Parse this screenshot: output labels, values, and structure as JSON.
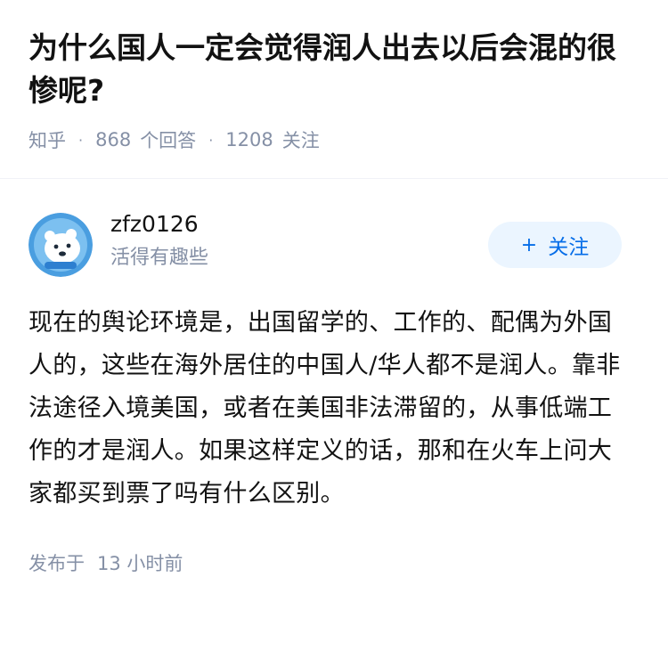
{
  "question": {
    "title": "为什么国人一定会觉得润人出去以后会混的很惨呢?",
    "source": "知乎",
    "answer_count": "868",
    "answer_label": "个回答",
    "follower_count": "1208",
    "follower_label": "关注"
  },
  "answer": {
    "author_name": "zfz0126",
    "author_bio": "活得有趣些",
    "follow_button": {
      "icon": "+",
      "label": "关注"
    },
    "content": "现在的舆论环境是，出国留学的、工作的、配偶为外国人的，这些在海外居住的中国人/华人都不是润人。靠非法途径入境美国，或者在美国非法滞留的，从事低端工作的才是润人。如果这样定义的话，那和在火车上问大家都买到票了吗有什么区别。",
    "published_label": "发布于",
    "published_time": "13 小时前"
  },
  "colors": {
    "accent": "#056de8",
    "follow_bg": "#ebf5ff",
    "muted_text": "#8590a6",
    "avatar_bg": "#4a9ee0"
  }
}
